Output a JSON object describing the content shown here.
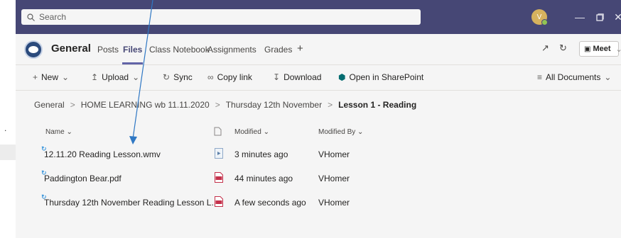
{
  "search": {
    "placeholder": "Search"
  },
  "user": {
    "initial": "V"
  },
  "channel": {
    "name": "General",
    "tabs": [
      "Posts",
      "Files",
      "Class Notebook",
      "Assignments",
      "Grades",
      "+"
    ],
    "active_tab": "Files",
    "meet_label": "Meet"
  },
  "toolbar": {
    "new": "New",
    "upload": "Upload",
    "sync": "Sync",
    "copy_link": "Copy link",
    "download": "Download",
    "open_sharepoint": "Open in SharePoint",
    "view": "All Documents"
  },
  "breadcrumb": [
    "General",
    "HOME LEARNING wb 11.11.2020",
    "Thursday 12th November",
    "Lesson 1 - Reading"
  ],
  "columns": {
    "name": "Name",
    "modified": "Modified",
    "modified_by": "Modified By"
  },
  "files": [
    {
      "name": "12.11.20 Reading Lesson.wmv",
      "type": "video",
      "modified": "3 minutes ago",
      "modified_by": "VHomer"
    },
    {
      "name": "Paddington Bear.pdf",
      "type": "pdf",
      "modified": "44 minutes ago",
      "modified_by": "VHomer"
    },
    {
      "name": "Thursday 12th November Reading Lesson L...",
      "type": "pdf",
      "modified": "A few seconds ago",
      "modified_by": "VHomer"
    }
  ],
  "colors": {
    "titlebar": "#464775",
    "accent": "#6264a7",
    "pdf": "#c4314b",
    "sync": "#0078d4",
    "arrow": "#2f78c4"
  }
}
